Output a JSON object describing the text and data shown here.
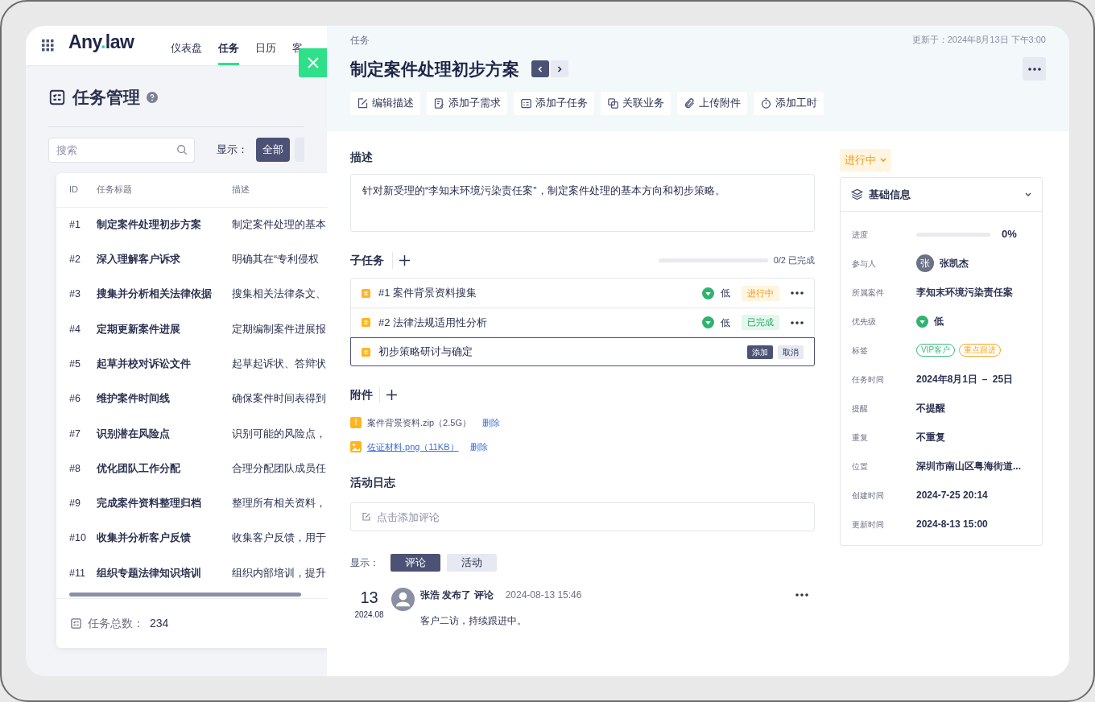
{
  "app": {
    "logo": {
      "before_dot": "Any",
      "dot": ".",
      "after_dot": "law"
    },
    "nav": [
      {
        "label": "仪表盘",
        "selected": false
      },
      {
        "label": "任务",
        "selected": true
      },
      {
        "label": "日历",
        "selected": false
      },
      {
        "label": "客",
        "selected": false
      }
    ]
  },
  "page": {
    "title": "任务管理",
    "search": {
      "placeholder": "搜索"
    },
    "filter_label": "显示：",
    "filters": [
      {
        "label": "全部",
        "selected": true
      }
    ],
    "table": {
      "columns": [
        "ID",
        "任务标题",
        "描述"
      ],
      "rows": [
        {
          "id": "#1",
          "title": "制定案件处理初步方案",
          "description": "制定案件处理的基本"
        },
        {
          "id": "#2",
          "title": "深入理解客户诉求",
          "description": "明确其在“专利侵权"
        },
        {
          "id": "#3",
          "title": "搜集并分析相关法律依据",
          "description": "搜集相关法律条文、"
        },
        {
          "id": "#4",
          "title": "定期更新案件进展",
          "description": "定期编制案件进展报"
        },
        {
          "id": "#5",
          "title": "起草并校对诉讼文件",
          "description": "起草起诉状、答辩状"
        },
        {
          "id": "#6",
          "title": "维护案件时间线",
          "description": "确保案件时间表得到"
        },
        {
          "id": "#7",
          "title": "识别潜在风险点",
          "description": "识别可能的风险点，"
        },
        {
          "id": "#8",
          "title": "优化团队工作分配",
          "description": "合理分配团队成员任"
        },
        {
          "id": "#9",
          "title": "完成案件资料整理归档",
          "description": "整理所有相关资料，"
        },
        {
          "id": "#10",
          "title": "收集并分析客户反馈",
          "description": "收集客户反馈，用于"
        },
        {
          "id": "#11",
          "title": "组织专题法律知识培训",
          "description": "组织内部培训，提升"
        }
      ],
      "total_label": "任务总数：",
      "total": "234"
    }
  },
  "drawer": {
    "breadcrumb": "任务",
    "updated": "更新于：2024年8月13日 下午3:00",
    "title": "制定案件处理初步方案",
    "actions": [
      {
        "label": "编辑描述",
        "kind": "edit"
      },
      {
        "label": "添加子需求",
        "kind": "requirement"
      },
      {
        "label": "添加子任务",
        "kind": "subtask"
      },
      {
        "label": "关联业务",
        "kind": "link"
      },
      {
        "label": "上传附件",
        "kind": "attach"
      },
      {
        "label": "添加工时",
        "kind": "timer"
      }
    ],
    "description": {
      "label": "描述",
      "text": "针对新受理的“李知末环境污染责任案”，制定案件处理的基本方向和初步策略。"
    },
    "subtasks": {
      "label": "子任务",
      "level": 0,
      "progress": "0/2 已完成",
      "items": [
        {
          "title": "#1 案件背景资料搜集",
          "priority": "低",
          "status": "进行中",
          "kind": "in_progress"
        },
        {
          "title": "#2 法律法规适用性分析",
          "priority": "低",
          "status": "已完成",
          "kind": "done"
        }
      ],
      "new_item": {
        "value": "初步策略研讨与确定",
        "confirm": "添加",
        "cancel": "取消"
      }
    },
    "attachments": {
      "label": "附件",
      "files": [
        {
          "kind": "zip",
          "name": "案件背景资料.zip（2.5G）",
          "action": "删除",
          "link": false
        },
        {
          "kind": "image",
          "name": "佐证材料.png（11KB）",
          "action": "删除",
          "link": true
        }
      ]
    },
    "activity": {
      "label": "活动日志",
      "comment": {
        "placeholder": "点击添加评论"
      },
      "filter_label": "显示：",
      "tabs": [
        {
          "label": "评论",
          "selected": true
        },
        {
          "label": "活动",
          "selected": false
        }
      ],
      "entries": [
        {
          "day": "13",
          "month": "2024.08",
          "author": "张浩",
          "verb": "发布了",
          "object": "评论",
          "time": "2024-08-13 15:46",
          "text": "客户二访，持续跟进中。"
        }
      ]
    },
    "sidebar": {
      "status": "进行中",
      "info": {
        "title": "基础信息",
        "expanded": true,
        "fields": [
          {
            "kind": "progress",
            "label": "进度",
            "level": 0,
            "reading": "0%"
          },
          {
            "kind": "person",
            "label": "参与人",
            "avatar": "张",
            "value": "张凯杰"
          },
          {
            "kind": "text",
            "label": "所属案件",
            "value": "李知末环境污染责任案"
          },
          {
            "kind": "priority",
            "label": "优先级",
            "value": "低"
          },
          {
            "kind": "tags",
            "label": "标签",
            "tags": [
              {
                "label": "VIP客户",
                "color": "#3dbb7e"
              },
              {
                "label": "重点跟进",
                "color": "#f5a623"
              }
            ]
          },
          {
            "kind": "text",
            "label": "任务时间",
            "value": "2024年8月1日 － 25日"
          },
          {
            "kind": "text",
            "label": "提醒",
            "value": "不提醒"
          },
          {
            "kind": "text",
            "label": "重复",
            "value": "不重复"
          },
          {
            "kind": "text",
            "label": "位置",
            "value": "深圳市南山区粤海街道..."
          },
          {
            "kind": "text",
            "label": "创建时间",
            "value": "2024-7-25 20:14"
          },
          {
            "kind": "text",
            "label": "更新时间",
            "value": "2024-8-13 15:00"
          }
        ]
      }
    }
  }
}
